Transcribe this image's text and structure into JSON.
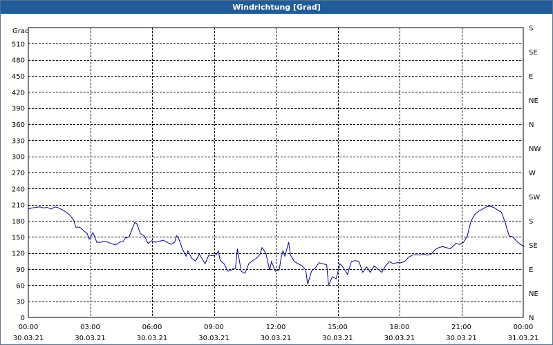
{
  "window": {
    "title": "Windrichtung [Grad]"
  },
  "chart_data": {
    "type": "line",
    "title": "Windrichtung [Grad]",
    "ylabel": "Grad",
    "xlabel": "",
    "ylim": [
      0,
      540
    ],
    "xlim_hours": [
      0,
      24
    ],
    "grid": true,
    "y_ticks": [
      0,
      30,
      60,
      90,
      120,
      150,
      180,
      210,
      240,
      270,
      300,
      330,
      360,
      390,
      420,
      450,
      480,
      510
    ],
    "y2_ticks": [
      {
        "value": 0,
        "label": "N"
      },
      {
        "value": 45,
        "label": "NE"
      },
      {
        "value": 90,
        "label": "E"
      },
      {
        "value": 135,
        "label": "SE"
      },
      {
        "value": 180,
        "label": "S"
      },
      {
        "value": 225,
        "label": "SW"
      },
      {
        "value": 270,
        "label": "W"
      },
      {
        "value": 315,
        "label": "NW"
      },
      {
        "value": 360,
        "label": "N"
      },
      {
        "value": 405,
        "label": "NE"
      },
      {
        "value": 450,
        "label": "E"
      },
      {
        "value": 495,
        "label": "SE"
      },
      {
        "value": 540,
        "label": "S"
      }
    ],
    "x_ticks": [
      {
        "hour": 0,
        "time": "00:00",
        "date": "30.03.21"
      },
      {
        "hour": 3,
        "time": "03:00",
        "date": "30.03.21"
      },
      {
        "hour": 6,
        "time": "06:00",
        "date": "30.03.21"
      },
      {
        "hour": 9,
        "time": "09:00",
        "date": "30.03.21"
      },
      {
        "hour": 12,
        "time": "12:00",
        "date": "30.03.21"
      },
      {
        "hour": 15,
        "time": "15:00",
        "date": "30.03.21"
      },
      {
        "hour": 18,
        "time": "18:00",
        "date": "30.03.21"
      },
      {
        "hour": 21,
        "time": "21:00",
        "date": "30.03.21"
      },
      {
        "hour": 24,
        "time": "00:00",
        "date": "31.03.21"
      }
    ],
    "series": [
      {
        "color": "#00008b",
        "points": [
          [
            0.0,
            202
          ],
          [
            0.2,
            204
          ],
          [
            0.4,
            205
          ],
          [
            0.6,
            206
          ],
          [
            0.8,
            204
          ],
          [
            1.0,
            205
          ],
          [
            1.2,
            202
          ],
          [
            1.4,
            206
          ],
          [
            1.6,
            204
          ],
          [
            1.8,
            200
          ],
          [
            2.0,
            196
          ],
          [
            2.2,
            190
          ],
          [
            2.4,
            180
          ],
          [
            2.5,
            168
          ],
          [
            2.7,
            168
          ],
          [
            2.9,
            162
          ],
          [
            3.1,
            156
          ],
          [
            3.2,
            146
          ],
          [
            3.4,
            158
          ],
          [
            3.6,
            140
          ],
          [
            3.8,
            140
          ],
          [
            4.0,
            142
          ],
          [
            4.2,
            140
          ],
          [
            4.4,
            137
          ],
          [
            4.6,
            135
          ],
          [
            4.8,
            140
          ],
          [
            5.0,
            142
          ],
          [
            5.1,
            148
          ],
          [
            5.3,
            150
          ],
          [
            5.5,
            168
          ],
          [
            5.6,
            177
          ],
          [
            5.7,
            175
          ],
          [
            5.9,
            156
          ],
          [
            6.1,
            152
          ],
          [
            6.3,
            138
          ],
          [
            6.5,
            143
          ],
          [
            6.7,
            140
          ],
          [
            6.9,
            142
          ],
          [
            7.1,
            144
          ],
          [
            7.3,
            140
          ],
          [
            7.5,
            136
          ],
          [
            7.7,
            140
          ],
          [
            7.8,
            152
          ],
          [
            7.9,
            148
          ],
          [
            8.1,
            128
          ],
          [
            8.3,
            114
          ],
          [
            8.4,
            124
          ],
          [
            8.6,
            110
          ],
          [
            8.8,
            105
          ],
          [
            9.0,
            118
          ],
          [
            9.1,
            112
          ],
          [
            9.3,
            100
          ],
          [
            9.5,
            116
          ],
          [
            9.7,
            115
          ],
          [
            9.9,
            117
          ],
          [
            10.0,
            124
          ],
          [
            10.1,
            106
          ],
          [
            10.3,
            100
          ],
          [
            10.5,
            86
          ],
          [
            10.7,
            88
          ],
          [
            10.8,
            92
          ],
          [
            10.9,
            91
          ],
          [
            11.0,
            128
          ],
          [
            11.2,
            86
          ],
          [
            11.4,
            82
          ],
          [
            11.6,
            100
          ],
          [
            11.8,
            106
          ],
          [
            12.0,
            110
          ],
          [
            12.2,
            118
          ],
          [
            12.3,
            130
          ],
          [
            12.5,
            120
          ],
          [
            12.7,
            88
          ],
          [
            12.8,
            104
          ],
          [
            13.0,
            86
          ],
          [
            13.2,
            88
          ],
          [
            13.3,
            110
          ],
          [
            13.4,
            124
          ],
          [
            13.5,
            114
          ],
          [
            13.7,
            140
          ],
          [
            13.8,
            116
          ],
          [
            14.0,
            104
          ],
          [
            14.2,
            100
          ],
          [
            14.4,
            96
          ],
          [
            14.6,
            88
          ],
          [
            14.7,
            62
          ],
          [
            14.9,
            86
          ],
          [
            15.1,
            92
          ],
          [
            15.3,
            102
          ],
          [
            15.5,
            100
          ],
          [
            15.7,
            98
          ],
          [
            15.8,
            60
          ],
          [
            16.0,
            76
          ],
          [
            16.2,
            72
          ],
          [
            16.4,
            100
          ],
          [
            16.5,
            96
          ],
          [
            16.7,
            86
          ],
          [
            16.8,
            80
          ],
          [
            17.0,
            104
          ],
          [
            17.2,
            106
          ],
          [
            17.4,
            104
          ],
          [
            17.6,
            84
          ],
          [
            17.8,
            94
          ],
          [
            18.0,
            84
          ],
          [
            18.2,
            96
          ],
          [
            18.4,
            90
          ],
          [
            18.6,
            84
          ],
          [
            18.8,
            96
          ],
          [
            19.0,
            104
          ],
          [
            19.2,
            100
          ],
          [
            19.4,
            102
          ],
          [
            19.6,
            102
          ],
          [
            19.8,
            104
          ],
          [
            20.0,
            112
          ],
          [
            20.2,
            116
          ],
          [
            20.4,
            117
          ],
          [
            20.6,
            116
          ],
          [
            20.8,
            118
          ],
          [
            21.0,
            116
          ],
          [
            21.2,
            118
          ],
          [
            21.4,
            126
          ],
          [
            21.6,
            130
          ],
          [
            21.8,
            132
          ],
          [
            22.0,
            130
          ],
          [
            22.2,
            128
          ],
          [
            22.4,
            134
          ],
          [
            22.5,
            138
          ],
          [
            22.7,
            136
          ],
          [
            22.9,
            140
          ],
          [
            23.1,
            152
          ],
          [
            23.3,
            180
          ],
          [
            23.5,
            192
          ],
          [
            23.7,
            198
          ],
          [
            23.9,
            202
          ],
          [
            24.1,
            206
          ],
          [
            24.3,
            207
          ],
          [
            24.5,
            205
          ],
          [
            24.7,
            200
          ],
          [
            24.9,
            196
          ],
          [
            25.1,
            176
          ],
          [
            25.3,
            152
          ],
          [
            25.5,
            150
          ],
          [
            25.7,
            142
          ],
          [
            25.9,
            136
          ],
          [
            26.1,
            132
          ]
        ]
      }
    ]
  }
}
